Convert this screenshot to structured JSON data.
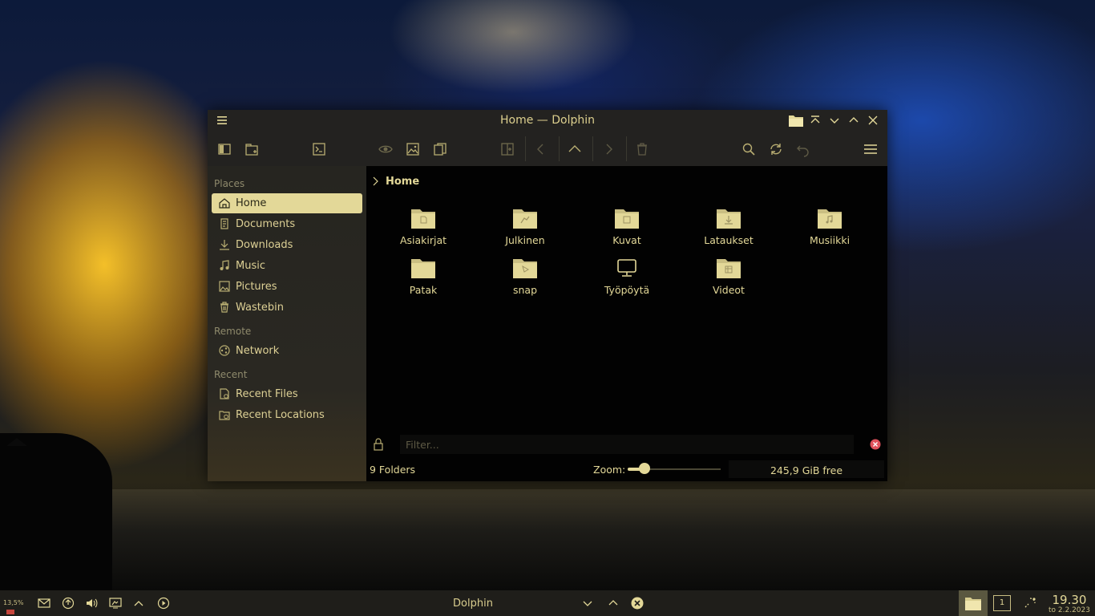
{
  "window": {
    "title": "Home — Dolphin"
  },
  "sidebar": {
    "sections": [
      {
        "title": "Places",
        "items": [
          {
            "label": "Home",
            "icon": "home-icon",
            "active": true
          },
          {
            "label": "Documents",
            "icon": "documents-icon"
          },
          {
            "label": "Downloads",
            "icon": "downloads-icon"
          },
          {
            "label": "Music",
            "icon": "music-icon"
          },
          {
            "label": "Pictures",
            "icon": "pictures-icon"
          },
          {
            "label": "Wastebin",
            "icon": "wastebin-icon"
          }
        ]
      },
      {
        "title": "Remote",
        "items": [
          {
            "label": "Network",
            "icon": "network-icon"
          }
        ]
      },
      {
        "title": "Recent",
        "items": [
          {
            "label": "Recent Files",
            "icon": "recent-files-icon"
          },
          {
            "label": "Recent Locations",
            "icon": "recent-locations-icon"
          }
        ]
      }
    ]
  },
  "breadcrumb": {
    "current": "Home"
  },
  "files": [
    {
      "name": "Asiakirjat",
      "icon": "folder-documents-icon"
    },
    {
      "name": "Julkinen",
      "icon": "folder-public-icon"
    },
    {
      "name": "Kuvat",
      "icon": "folder-pictures-icon"
    },
    {
      "name": "Lataukset",
      "icon": "folder-downloads-icon"
    },
    {
      "name": "Musiikki",
      "icon": "folder-music-icon"
    },
    {
      "name": "Patak",
      "icon": "folder-icon"
    },
    {
      "name": "snap",
      "icon": "folder-snap-icon"
    },
    {
      "name": "Työpöytä",
      "icon": "desktop-icon"
    },
    {
      "name": "Videot",
      "icon": "folder-videos-icon"
    }
  ],
  "filter": {
    "placeholder": "Filter..."
  },
  "status": {
    "summary": "9 Folders",
    "zoom_label": "Zoom:",
    "zoom_level": 0.18,
    "free_space": "245,9 GiB free"
  },
  "panel": {
    "cpu": "13,5%",
    "task_title": "Dolphin",
    "desktop_number": "1",
    "time": "19.30",
    "date": "to 2.2.2023"
  },
  "colors": {
    "accent": "#e3d898",
    "content_bg": "#020202",
    "sidebar_bg": "#262520"
  }
}
